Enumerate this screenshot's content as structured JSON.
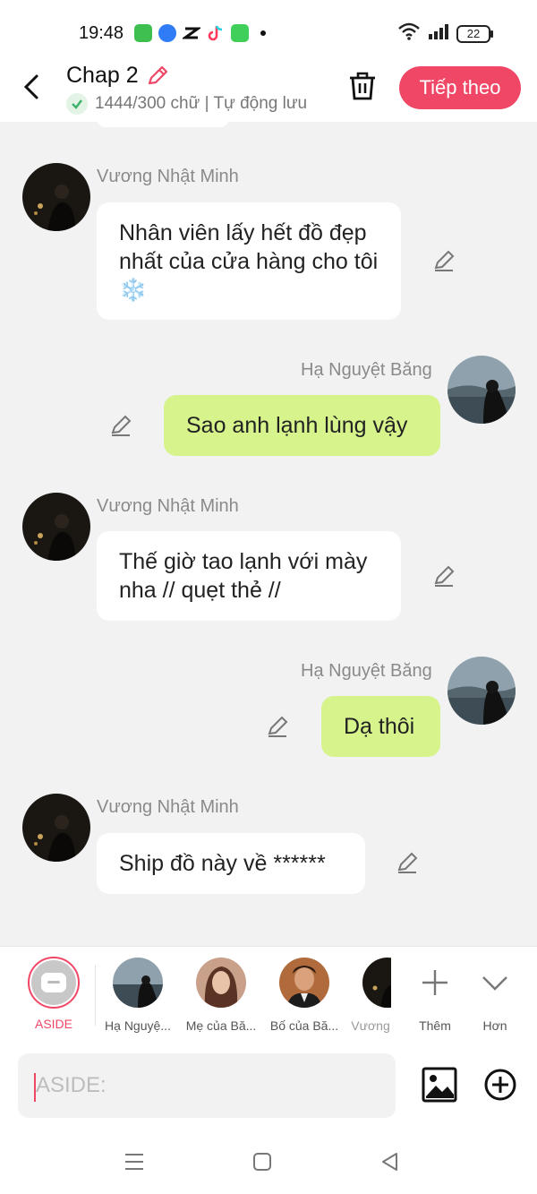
{
  "status_bar": {
    "time": "19:48",
    "battery": "22",
    "apps": [
      "app-green-icon",
      "app-blue-icon",
      "capcut-icon",
      "tiktok-icon",
      "messages-icon"
    ]
  },
  "header": {
    "title": "Chap 2",
    "subtitle": "1444/300 chữ | Tự động lưu",
    "next_label": "Tiếp theo"
  },
  "messages": [
    {
      "side": "left",
      "name": "Vương Nhật Minh",
      "text": "Nhân viên lấy hết đồ đẹp nhất của cửa hàng cho tôi ❄️"
    },
    {
      "side": "right",
      "name": "Hạ Nguyệt Băng",
      "text": "Sao anh lạnh lùng vậy"
    },
    {
      "side": "left",
      "name": "Vương Nhật Minh",
      "text": "Thế giờ tao lạnh với mày nha // quẹt thẻ //"
    },
    {
      "side": "right",
      "name": "Hạ Nguyệt Băng",
      "text": "Dạ thôi"
    },
    {
      "side": "left",
      "name": "Vương Nhật Minh",
      "text": "Ship đồ này về ******"
    }
  ],
  "characters": {
    "aside_label": "ASIDE",
    "items": [
      {
        "label": "Hạ Nguyệ..."
      },
      {
        "label": "Mẹ của Bă..."
      },
      {
        "label": "Bố của Bă..."
      },
      {
        "label": "Vương"
      }
    ],
    "more_label": "Thêm",
    "expand_label": "Hơn"
  },
  "input": {
    "placeholder": "ASIDE:"
  },
  "colors": {
    "accent": "#f04766",
    "right_bubble": "#d6f38c",
    "chat_bg": "#f2f2f2"
  }
}
